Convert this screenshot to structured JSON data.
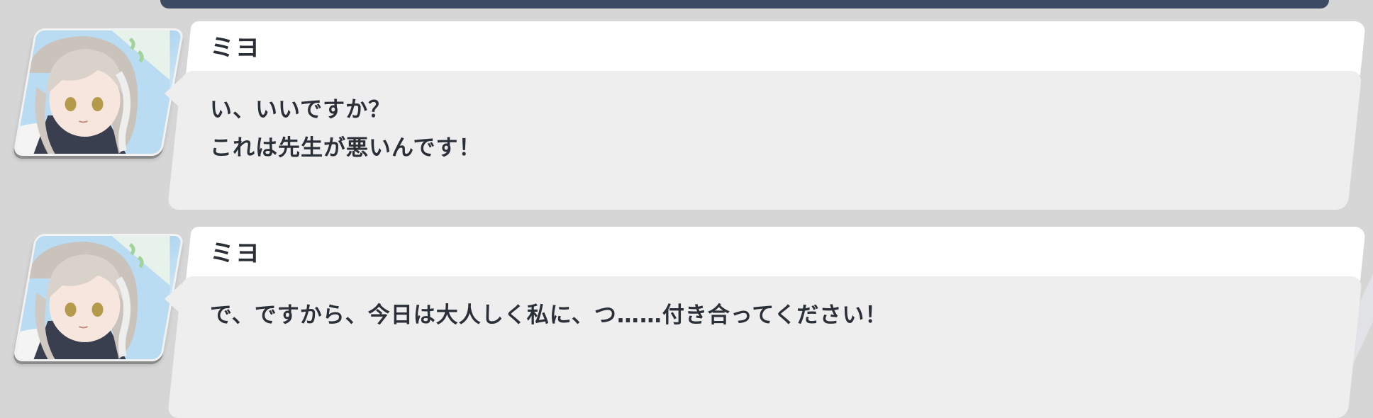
{
  "top_bar": {
    "color": "#3d4a63"
  },
  "messages": [
    {
      "speaker": "ミヨ",
      "avatar_icon": "character-portrait",
      "lines": [
        "い、いいですか？",
        "これは先生が悪いんです！"
      ]
    },
    {
      "speaker": "ミヨ",
      "avatar_icon": "character-portrait",
      "lines": [
        "で、ですから、今日は大人しく私に、つ……付き合ってください！"
      ]
    }
  ],
  "colors": {
    "background": "#d6d6d7",
    "name_bar": "#ffffff",
    "bubble": "#eeeeee",
    "text": "#2b2f38"
  }
}
